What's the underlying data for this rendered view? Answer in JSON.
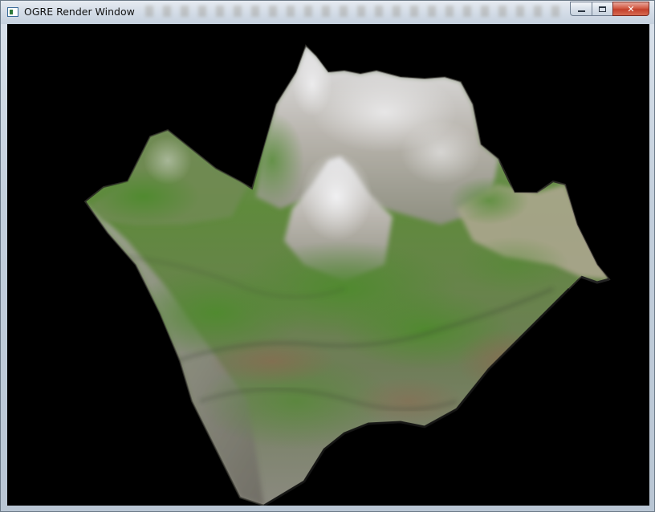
{
  "window": {
    "title": "OGRE Render Window",
    "icon": "app-window-icon"
  },
  "caption_buttons": {
    "minimize_icon": "minimize-icon",
    "maximize_icon": "maximize-icon",
    "close_label": "✕"
  },
  "viewport": {
    "background": "#000000",
    "content": "terrain-render"
  },
  "colors": {
    "grass": "#5f8a3c",
    "rock": "#b8b4ad",
    "snow": "#e4e4e6",
    "soil": "#8a7760"
  }
}
